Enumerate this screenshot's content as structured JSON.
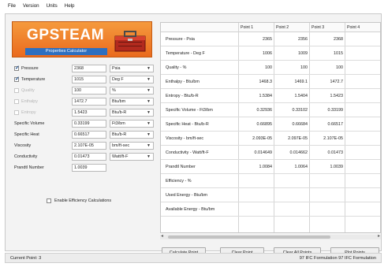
{
  "menu": [
    "File",
    "Version",
    "Units",
    "Help"
  ],
  "logo": {
    "title": "GPSTEAM",
    "subtitle": "Properties Calculator"
  },
  "inputs": [
    {
      "label": "Pressure",
      "checkbox": true,
      "checked": true,
      "disabled": false,
      "value": "2368",
      "unit": "Psia"
    },
    {
      "label": "Temperature",
      "checkbox": true,
      "checked": true,
      "disabled": false,
      "value": "1015",
      "unit": "Deg F"
    },
    {
      "label": "Quality",
      "checkbox": true,
      "checked": false,
      "disabled": true,
      "value": "100",
      "unit": "%"
    },
    {
      "label": "Enthalpy",
      "checkbox": true,
      "checked": false,
      "disabled": true,
      "value": "1472.7",
      "unit": "Btu/bm"
    },
    {
      "label": "Entropy",
      "checkbox": true,
      "checked": false,
      "disabled": true,
      "value": "1.5423",
      "unit": "Btu/b-R"
    },
    {
      "label": "Specific Volume",
      "checkbox": false,
      "checked": false,
      "disabled": false,
      "value": "0.33199",
      "unit": "Ft3/bm"
    },
    {
      "label": "Specific Heat",
      "checkbox": false,
      "checked": false,
      "disabled": false,
      "value": "0.66517",
      "unit": "Btu/b-R"
    },
    {
      "label": "Viscosity",
      "checkbox": false,
      "checked": false,
      "disabled": false,
      "value": "2.107E-05",
      "unit": "bm/ft-sec"
    },
    {
      "label": "Conductivity",
      "checkbox": false,
      "checked": false,
      "disabled": false,
      "value": "0.01473",
      "unit": "Watt/ft-F"
    },
    {
      "label": "Prandtl Number",
      "checkbox": false,
      "checked": false,
      "disabled": false,
      "value": "1.0039",
      "unit": ""
    }
  ],
  "efficiency_label": "Enable Efficiency Calculations",
  "grid": {
    "headers": [
      "Point 1",
      "Point 2",
      "Point 3",
      "Point 4"
    ],
    "rows": [
      {
        "name": "Pressure - Psia",
        "values": [
          "2365",
          "2356",
          "2368",
          ""
        ]
      },
      {
        "name": "Temperature - Deg F",
        "values": [
          "1006",
          "1009",
          "1015",
          ""
        ]
      },
      {
        "name": "Quality - %",
        "values": [
          "100",
          "100",
          "100",
          ""
        ]
      },
      {
        "name": "Enthalpy - Btu/bm",
        "values": [
          "1468.3",
          "1469.1",
          "1472.7",
          ""
        ]
      },
      {
        "name": "Entropy - Btu/b-R",
        "values": [
          "1.5384",
          "1.5404",
          "1.5423",
          ""
        ]
      },
      {
        "name": "Specific Volume - Ft3/bm",
        "values": [
          "0.32936",
          "0.33102",
          "0.33199",
          ""
        ]
      },
      {
        "name": "Specific Heat - Btu/b-R",
        "values": [
          "0.66895",
          "0.66684",
          "0.66517",
          ""
        ]
      },
      {
        "name": "Viscosity - bm/ft-sec",
        "values": [
          "2.093E-05",
          "2.097E-05",
          "2.107E-05",
          ""
        ]
      },
      {
        "name": "Conductivity - Watt/ft-F",
        "values": [
          "0.014649",
          "0.014662",
          "0.01473",
          ""
        ]
      },
      {
        "name": "Prandtl Number",
        "values": [
          "1.0084",
          "1.0064",
          "1.0039",
          ""
        ]
      },
      {
        "name": "Efficiency - %",
        "values": [
          "",
          "",
          "",
          ""
        ]
      },
      {
        "name": "Used Energy - Btu/bm",
        "values": [
          "",
          "",
          "",
          ""
        ]
      },
      {
        "name": "Available Energy - Btu/bm",
        "values": [
          "",
          "",
          "",
          ""
        ]
      }
    ]
  },
  "buttons": [
    "Calculate Point",
    "Clear Point",
    "Clear All Points",
    "Plot Points"
  ],
  "status": {
    "left": "Current Point: 3",
    "right": "97 IFC Formulation   97 IFC Formulation"
  },
  "colors": {
    "logo_orange": "#ea6a1e",
    "logo_blue": "#2d6fc0",
    "check_blue": "#1b4d8c"
  }
}
